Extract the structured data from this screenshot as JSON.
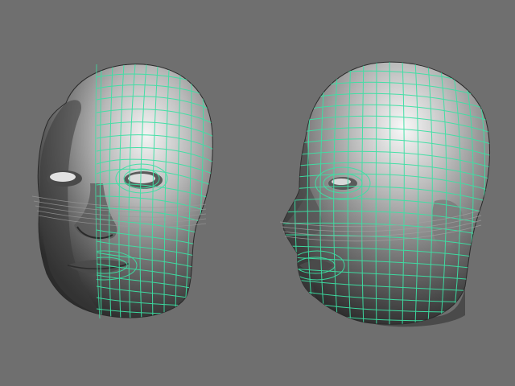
{
  "viewport": {
    "background_color": "#6f6f6f"
  },
  "objects": [
    {
      "name": "head-front-view",
      "description_kind": "3d-head-model",
      "wire_color": "#3de0a4",
      "shade_light": "#f2f2f2",
      "shade_dark": "#2e2e2e"
    },
    {
      "name": "head-three-quarter-view",
      "description_kind": "3d-head-model",
      "wire_color": "#3de0a4",
      "shade_light": "#f5f5f5",
      "shade_dark": "#2a2a2a"
    }
  ]
}
